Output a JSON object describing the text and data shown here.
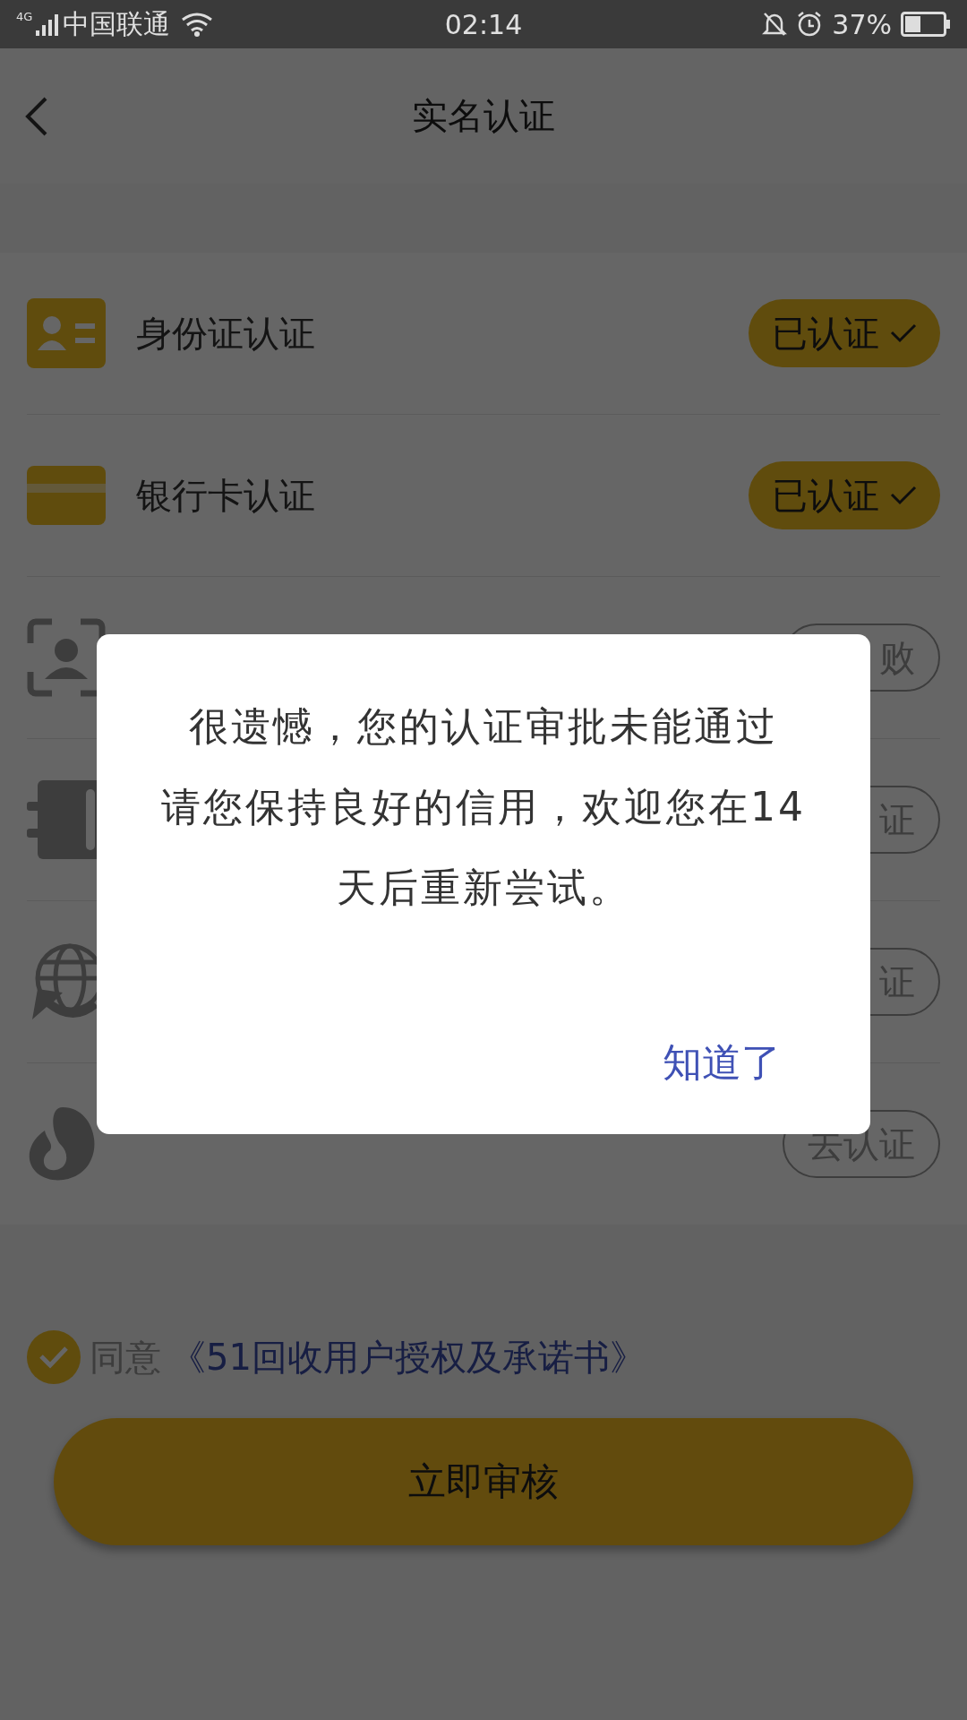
{
  "status_bar": {
    "network": "4G",
    "carrier": "中国联通",
    "time": "02:14",
    "battery_text": "37%"
  },
  "header": {
    "title": "实名认证"
  },
  "rows": [
    {
      "kind": "id-card",
      "title": "身份证认证",
      "status": "已认证",
      "verified": true
    },
    {
      "kind": "bank-card",
      "title": "银行卡认证",
      "status": "已认证",
      "verified": true
    },
    {
      "kind": "face",
      "status": "败",
      "verified": false
    },
    {
      "kind": "phone-book",
      "status": "证",
      "verified": false
    },
    {
      "kind": "globe",
      "status": "证",
      "verified": false
    },
    {
      "kind": "sesame",
      "status": "去认证",
      "verified": false
    }
  ],
  "agreement": {
    "checked": true,
    "prefix": "同意",
    "link": "《51回收用户授权及承诺书》"
  },
  "submit_button": "立即审核",
  "dialog": {
    "lines": [
      "很遗憾，您的认证审批未能通过",
      "请您保持良好的信用，欢迎您在14",
      "天后重新尝试。"
    ],
    "button": "知道了"
  }
}
